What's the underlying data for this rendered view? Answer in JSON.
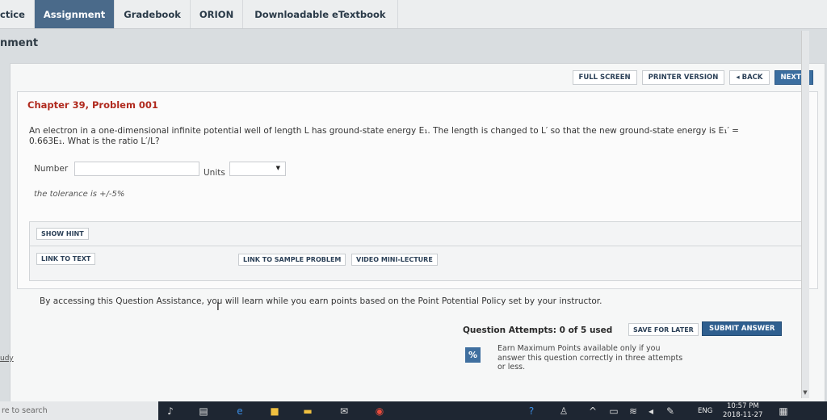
{
  "tabs": [
    {
      "label": "ctice"
    },
    {
      "label": "Assignment"
    },
    {
      "label": "Gradebook"
    },
    {
      "label": "ORION"
    },
    {
      "label": "Downloadable eTextbook"
    }
  ],
  "page_heading": "nment",
  "toolbar": {
    "full_screen": "FULL SCREEN",
    "printer_version": "PRINTER VERSION",
    "back": "◂ BACK",
    "next": "NEXT ▸"
  },
  "question": {
    "chapter_title": "Chapter 39, Problem 001",
    "text_line1": "An electron in a one-dimensional infinite potential well of length L has ground-state energy E₁. The length is changed to L′ so that the new ground-state energy is E₁′ =",
    "text_line2": "0.663E₁. What is the ratio L′/L?",
    "number_label": "Number",
    "number_value": "",
    "units_label": "Units",
    "units_value": "",
    "tolerance": "the tolerance is +/-5%"
  },
  "assistance": {
    "show_hint": "SHOW HINT",
    "link_to_text": "LINK TO TEXT",
    "link_to_sample": "LINK TO SAMPLE PROBLEM",
    "video_lecture": "VIDEO MINI-LECTURE",
    "note": "By accessing this Question Assistance, you will learn while you earn points based on the Point Potential Policy set by your instructor."
  },
  "attempts": {
    "label": "Question Attempts: 0 of 5 used",
    "save_later": "SAVE FOR LATER",
    "submit": "SUBMIT ANSWER",
    "pct_icon": "%",
    "earn_text": "Earn Maximum Points available only if you answer this question correctly in three attempts or less."
  },
  "side_link": "udy",
  "taskbar": {
    "search_placeholder": "re to search",
    "lang": "ENG",
    "time": "10:57 PM",
    "date": "2018-11-27"
  },
  "colors": {
    "accent": "#4a6a8a",
    "chapter_title": "#b02a1e",
    "submit": "#2f5f8f"
  }
}
